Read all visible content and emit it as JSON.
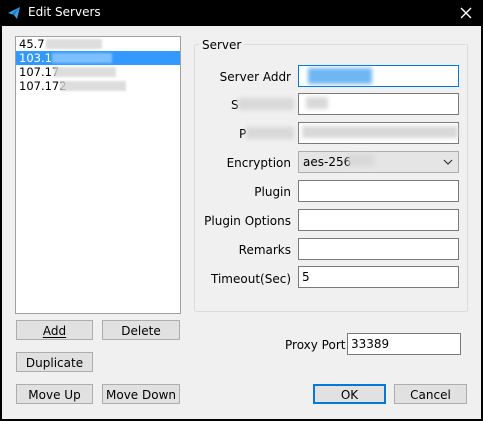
{
  "window": {
    "title": "Edit Servers"
  },
  "servers": [
    {
      "label": "45.7",
      "selected": false
    },
    {
      "label": "103.1",
      "selected": true
    },
    {
      "label": "107.17",
      "selected": false
    },
    {
      "label": "107.172",
      "selected": false
    }
  ],
  "buttons": {
    "add": "Add",
    "delete": "Delete",
    "duplicate": "Duplicate",
    "move_up": "Move Up",
    "move_down": "Move Down",
    "ok": "OK",
    "cancel": "Cancel"
  },
  "server_group": {
    "legend": "Server",
    "server_addr_label": "Server Addr",
    "server_port_label": "S",
    "password_label": "P",
    "encryption_label": "Encryption",
    "encryption_value": "aes-256",
    "plugin_label": "Plugin",
    "plugin_value": "",
    "plugin_options_label": "Plugin Options",
    "plugin_options_value": "",
    "remarks_label": "Remarks",
    "remarks_value": "",
    "timeout_label": "Timeout(Sec)",
    "timeout_value": "5"
  },
  "proxy": {
    "label": "Proxy Port",
    "value": "33389"
  },
  "colors": {
    "selection": "#3399ff",
    "focus_border": "#0078d7",
    "dialog_bg": "#f0f0f0"
  },
  "icons": {
    "title": "paper-plane-icon",
    "close": "close-icon",
    "dropdown": "chevron-down-icon"
  }
}
